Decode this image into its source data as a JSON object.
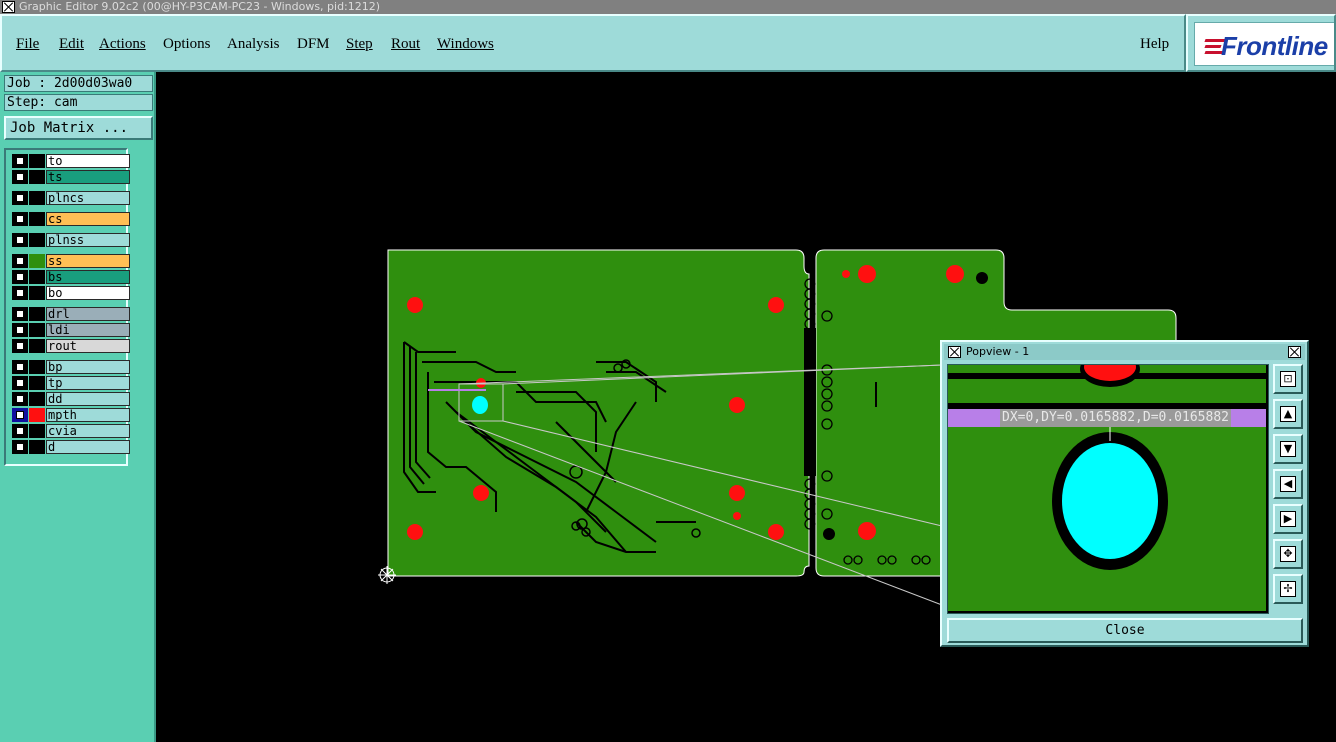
{
  "window": {
    "title": "Graphic Editor 9.02c2 (00@HY-P3CAM-PC23 - Windows, pid:1212)"
  },
  "menu": {
    "items": [
      {
        "label": "File"
      },
      {
        "label": "Edit"
      },
      {
        "label": "Actions"
      },
      {
        "label": "Options"
      },
      {
        "label": "Analysis"
      },
      {
        "label": "DFM"
      },
      {
        "label": "Step"
      },
      {
        "label": "Rout"
      },
      {
        "label": "Windows"
      }
    ],
    "help": "Help"
  },
  "logo": {
    "text": "Frontline"
  },
  "panel": {
    "job": "Job : 2d00d03wa0",
    "step": "Step: cam",
    "job_matrix": "Job Matrix ..."
  },
  "layers": [
    {
      "name": "to",
      "color": "#ffffff",
      "flag": "✎"
    },
    {
      "name": "ts",
      "color": "#199e7e",
      "flag": "✎"
    },
    {
      "name": "plncs",
      "color": "#9edbd9",
      "flag": ""
    },
    {
      "name": "cs",
      "color": "#ffbf55",
      "flag": "✎"
    },
    {
      "name": "plnss",
      "color": "#9edbd9",
      "flag": ""
    },
    {
      "name": "ss",
      "color": "#ffbf55",
      "flag": "✎"
    },
    {
      "name": "bs",
      "color": "#199e7e",
      "flag": "✎"
    },
    {
      "name": "bo",
      "color": "#ffffff",
      "flag": "✎"
    },
    {
      "name": "drl",
      "color": "#9aaeb8",
      "flag": ""
    },
    {
      "name": "ldi",
      "color": "#9aaeb8",
      "flag": ""
    },
    {
      "name": "rout",
      "color": "#d8d8d8",
      "flag": ""
    },
    {
      "name": "bp",
      "color": "#9edbd9",
      "flag": "✎"
    },
    {
      "name": "tp",
      "color": "#9edbd9",
      "flag": "✎"
    },
    {
      "name": "dd",
      "color": "#9edbd9",
      "flag": "✎"
    },
    {
      "name": "mpth",
      "color": "#9edbd9",
      "flag": "⊞"
    },
    {
      "name": "cvia",
      "color": "#9edbd9",
      "flag": ""
    },
    {
      "name": "d",
      "color": "#9edbd9",
      "flag": ""
    }
  ],
  "colors": {
    "board": "#2f8f0e",
    "pad_red": "#ff1010",
    "pad_cyan": "#00ffff",
    "panel_teal": "#5acfb2",
    "menu_cyan": "#9edbd9",
    "measure": "#b87fe8"
  },
  "popview": {
    "title": "Popview - 1",
    "measurement": "DX=0,DY=0.0165882,D=0.0165882",
    "close_label": "Close",
    "buttons": [
      {
        "name": "zoom-home-icon",
        "glyph": "⊡"
      },
      {
        "name": "pan-up-icon",
        "glyph": "▲"
      },
      {
        "name": "pan-down-icon",
        "glyph": "▼"
      },
      {
        "name": "pan-left-icon",
        "glyph": "◀"
      },
      {
        "name": "pan-right-icon",
        "glyph": "▶"
      },
      {
        "name": "zoom-out-icon",
        "glyph": "✥"
      },
      {
        "name": "zoom-in-icon",
        "glyph": "✢"
      }
    ]
  }
}
